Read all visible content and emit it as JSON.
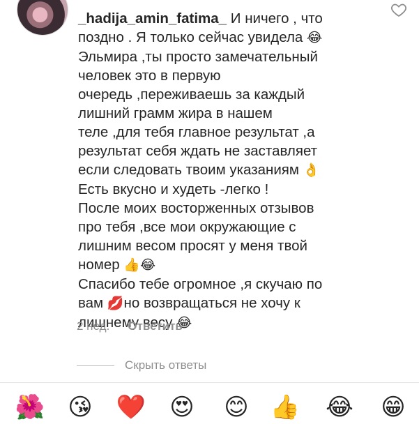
{
  "comment": {
    "username": "_hadija_amin_fatima_",
    "line1_text": " И ничего , что",
    "line2_text": "поздно . Я только сейчас увидела",
    "line3_text": "Эльмира ,ты просто замечательный",
    "line4_text": "человек это в первую",
    "line5_text": "очередь ,переживаешь за каждый",
    "line6_text": "лишний грамм жира в нашем",
    "line7_text": "теле ,для тебя главное результат ,а",
    "line8_text": "результат себя ждать не заставляет",
    "line9_text": "если следовать твоим указаниям",
    "line10_text": "Есть вкусно и худеть -легко !",
    "line11_text": "После моих восторженных отзывов",
    "line12_text": "про тебя ,все мои окружающие с",
    "line13_text": "лишним весом просят у меня твой",
    "line14_text": "номер",
    "line15_text": "Спасибо тебе огромное ,я скучаю по",
    "line16_text": "вам",
    "line16b_text": "но возвращаться не хочу к",
    "line17_text": "лишнему весу",
    "emoji_laugh": "😂",
    "emoji_ok": "👌",
    "emoji_thumbs": "👍",
    "emoji_kiss": "💋"
  },
  "meta": {
    "time": "2 нед.",
    "reply_label": "Ответить"
  },
  "hide_replies_label": "Скрыть ответы",
  "emoji_bar": [
    "🌺",
    "😘",
    "❤️",
    "😍",
    "😊",
    "👍",
    "😂",
    "😁"
  ],
  "colors": {
    "text": "#262626",
    "secondary": "#8e8e8e"
  }
}
